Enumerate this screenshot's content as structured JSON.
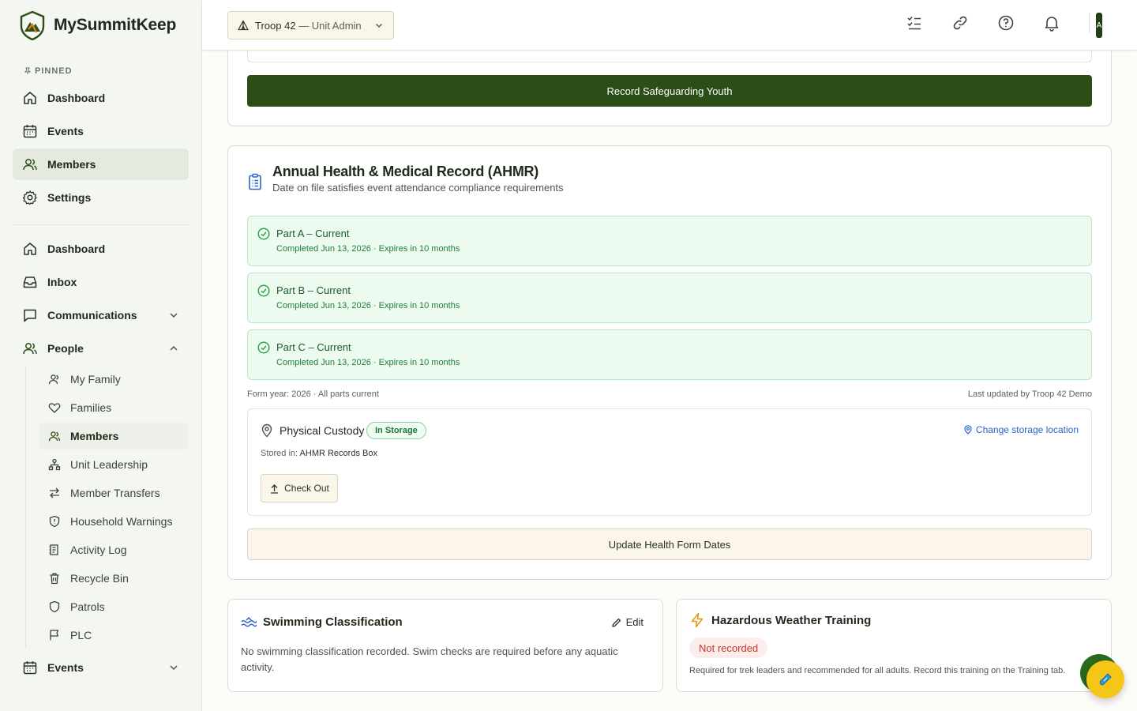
{
  "brand": {
    "name": "MySummitKeep"
  },
  "sidebar": {
    "pinned_label": "PINNED",
    "pinned": [
      {
        "label": "Dashboard",
        "icon": "home-icon"
      },
      {
        "label": "Events",
        "icon": "calendar-icon"
      },
      {
        "label": "Members",
        "icon": "users-icon",
        "active": true
      },
      {
        "label": "Settings",
        "icon": "gear-icon"
      }
    ],
    "nav": [
      {
        "label": "Dashboard",
        "icon": "home-icon"
      },
      {
        "label": "Inbox",
        "icon": "inbox-icon"
      },
      {
        "label": "Communications",
        "icon": "message-icon",
        "expanded": false
      },
      {
        "label": "People",
        "icon": "users-icon",
        "expanded": true
      }
    ],
    "people_items": [
      {
        "label": "My Family",
        "icon": "user-icon"
      },
      {
        "label": "Families",
        "icon": "heart-icon"
      },
      {
        "label": "Members",
        "icon": "users-icon",
        "active": true
      },
      {
        "label": "Unit Leadership",
        "icon": "org-chart-icon"
      },
      {
        "label": "Member Transfers",
        "icon": "transfer-icon"
      },
      {
        "label": "Household Warnings",
        "icon": "shield-alert-icon"
      },
      {
        "label": "Activity Log",
        "icon": "log-icon"
      },
      {
        "label": "Recycle Bin",
        "icon": "trash-icon"
      },
      {
        "label": "Patrols",
        "icon": "shield-icon"
      },
      {
        "label": "PLC",
        "icon": "flag-icon"
      }
    ],
    "events_section": {
      "label": "Events",
      "icon": "calendar-icon"
    }
  },
  "topbar": {
    "unit_name": "Troop 42",
    "unit_role": " — Unit Admin",
    "avatar_initial": "A"
  },
  "safeguarding": {
    "button_label": "Record Safeguarding Youth"
  },
  "ahmr": {
    "title": "Annual Health & Medical Record (AHMR)",
    "subtitle": "Date on file satisfies event attendance compliance requirements",
    "parts": [
      {
        "title": "Part A – Current",
        "meta": "Completed Jun 13, 2026 · Expires in 10 months"
      },
      {
        "title": "Part B – Current",
        "meta": "Completed Jun 13, 2026 · Expires in 10 months"
      },
      {
        "title": "Part C – Current",
        "meta": "Completed Jun 13, 2026 · Expires in 10 months"
      }
    ],
    "form_year": "Form year: 2026 · All parts current",
    "last_updated": "Last updated by Troop 42 Demo",
    "custody": {
      "title": "Physical Custody",
      "badge": "In Storage",
      "change_label": "Change storage location",
      "stored_prefix": "Stored in: ",
      "stored_value": "AHMR Records Box",
      "checkout_label": "Check Out"
    },
    "update_button": "Update Health Form Dates"
  },
  "swimming": {
    "title": "Swimming Classification",
    "edit_label": "Edit",
    "text": "No swimming classification recorded. Swim checks are required before any aquatic activity."
  },
  "hazardous": {
    "title": "Hazardous Weather Training",
    "status": "Not recorded",
    "text": "Required for trek leaders and recommended for all adults. Record this training on the Training tab."
  },
  "colors": {
    "primary": "#2b4d17",
    "success_bg": "#ecfaef",
    "success_text": "#1e5a2b",
    "link": "#2d63c8",
    "danger": "#c0392b",
    "fab": "#f5c518"
  }
}
